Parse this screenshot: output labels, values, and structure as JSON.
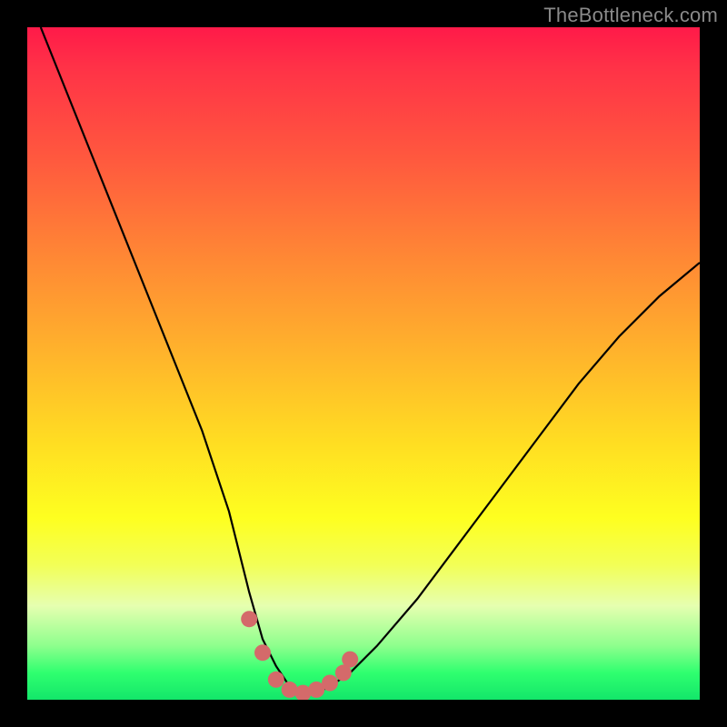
{
  "watermark": "TheBottleneck.com",
  "chart_data": {
    "type": "line",
    "title": "",
    "xlabel": "",
    "ylabel": "",
    "xlim": [
      0,
      100
    ],
    "ylim": [
      0,
      100
    ],
    "series": [
      {
        "name": "bottleneck-curve",
        "x": [
          2,
          6,
          10,
          14,
          18,
          22,
          26,
          30,
          33,
          35,
          37,
          39,
          41,
          43,
          45,
          48,
          52,
          58,
          64,
          70,
          76,
          82,
          88,
          94,
          100
        ],
        "y": [
          100,
          90,
          80,
          70,
          60,
          50,
          40,
          28,
          16,
          9,
          5,
          2,
          1,
          1,
          2,
          4,
          8,
          15,
          23,
          31,
          39,
          47,
          54,
          60,
          65
        ]
      }
    ],
    "markers": {
      "name": "highlight-points",
      "color": "#d46a6a",
      "x": [
        33,
        35,
        37,
        39,
        41,
        43,
        45,
        47,
        48
      ],
      "y": [
        12,
        7,
        3,
        1.5,
        1,
        1.5,
        2.5,
        4,
        6
      ]
    },
    "gradient_stops": [
      {
        "pos": 0,
        "color": "#ff1a49"
      },
      {
        "pos": 25,
        "color": "#ff7a38"
      },
      {
        "pos": 50,
        "color": "#ffc226"
      },
      {
        "pos": 75,
        "color": "#fcff2a"
      },
      {
        "pos": 95,
        "color": "#3fff72"
      },
      {
        "pos": 100,
        "color": "#13e66a"
      }
    ]
  }
}
